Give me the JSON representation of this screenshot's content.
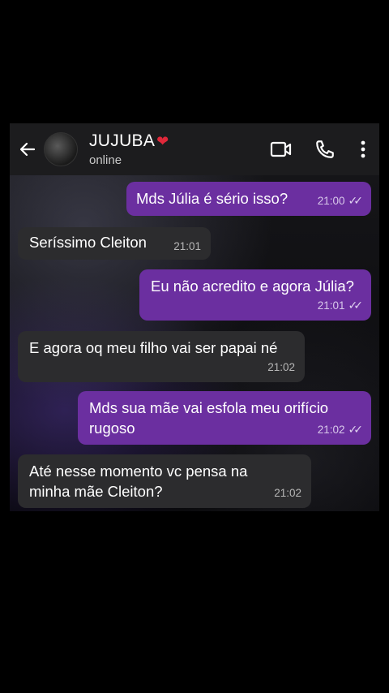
{
  "header": {
    "contact_name": "JUJUBA",
    "heart": "❤",
    "status": "online"
  },
  "messages": [
    {
      "dir": "out",
      "text": "Mds Júlia é sério isso?",
      "time": "21:00",
      "ticks": "✓✓"
    },
    {
      "dir": "in",
      "text": "Seríssimo Cleiton",
      "time": "21:01"
    },
    {
      "dir": "out",
      "text": "Eu não acredito e agora Júlia?",
      "time": "21:01",
      "ticks": "✓✓"
    },
    {
      "dir": "in",
      "text": "E agora oq meu filho vai ser papai né",
      "time": "21:02"
    },
    {
      "dir": "out",
      "text_line1": "Mds sua mãe vai esfola meu orifício",
      "text_line2": "rugoso",
      "time": "21:02",
      "ticks": "✓✓"
    },
    {
      "dir": "in",
      "text_line1": "Até nesse momento vc pensa na",
      "text_line2": "minha mãe Cleiton?",
      "time": "21:02"
    }
  ],
  "icons": {
    "back": "arrow-left-icon",
    "avatar": "avatar",
    "video": "video-call-icon",
    "call": "phone-icon",
    "menu": "more-vertical-icon"
  },
  "colors": {
    "outgoing_bubble": "#6b2fa0",
    "incoming_bubble": "#2c2c2e",
    "header": "#1c1c1e",
    "heart": "#e0283a"
  }
}
